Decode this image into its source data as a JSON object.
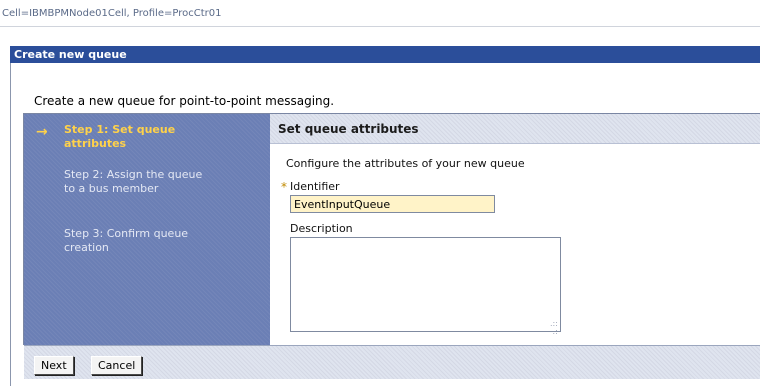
{
  "context": {
    "scope_text": "Cell=IBMBPMNode01Cell, Profile=ProcCtr01"
  },
  "panel": {
    "title": "Create new queue"
  },
  "intro_text": "Create a new queue for point-to-point messaging.",
  "wizard": {
    "current_step_marker": "→",
    "steps": [
      {
        "label": "Step 1: Set queue attributes",
        "active": true
      },
      {
        "label": "Step 2: Assign the queue to a bus member",
        "active": false
      },
      {
        "label": "Step 3: Confirm queue creation",
        "active": false
      }
    ]
  },
  "form": {
    "section_title": "Set queue attributes",
    "instructions": "Configure the attributes of your new queue",
    "required_marker": "*",
    "identifier": {
      "label": "Identifier",
      "value": "EventInputQueue"
    },
    "description": {
      "label": "Description",
      "value": ""
    }
  },
  "buttons": {
    "next": "Next",
    "cancel": "Cancel"
  },
  "colors": {
    "title_bar": "#2b4e9a",
    "step_panel": "#6b7fb5",
    "active_step": "#ffd24a",
    "required_field_bg": "#fff3c8"
  }
}
